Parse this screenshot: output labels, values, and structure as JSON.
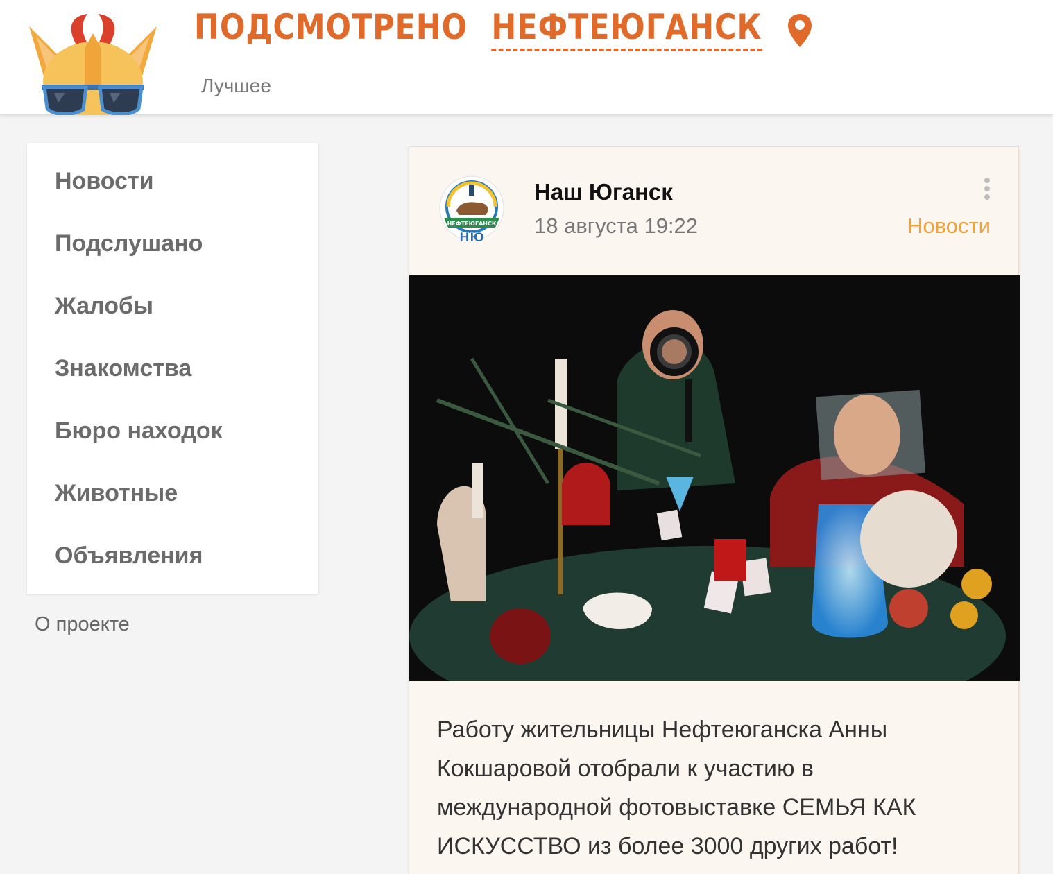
{
  "header": {
    "title_part1": "ПОДСМОТРЕНО",
    "title_city": "НЕФТЕЮГАНСК",
    "subnav_label": "Лучшее",
    "pin_icon": "location-pin-icon",
    "brand_color": "#e06a2a"
  },
  "sidebar": {
    "items": [
      {
        "label": "Новости"
      },
      {
        "label": "Подслушано"
      },
      {
        "label": "Жалобы"
      },
      {
        "label": "Знакомства"
      },
      {
        "label": "Бюро находок"
      },
      {
        "label": "Животные"
      },
      {
        "label": "Объявления"
      }
    ],
    "about_label": "О проекте"
  },
  "post": {
    "author": "Наш Юганск",
    "date": "18 августа 19:22",
    "category": "Новости",
    "category_color": "#f0a23c",
    "avatar_text_top": "НЕФТЕЮГАНСК",
    "avatar_text_bottom": "НЮ",
    "more_icon": "kebab-menu-icon",
    "text": "Работу жительницы Нефтеюганска Анны Кокшаровой отобрали к участию в международной фотовыставке СЕМЬЯ КАК ИСКУССТВО из более 3000 других работ!"
  }
}
